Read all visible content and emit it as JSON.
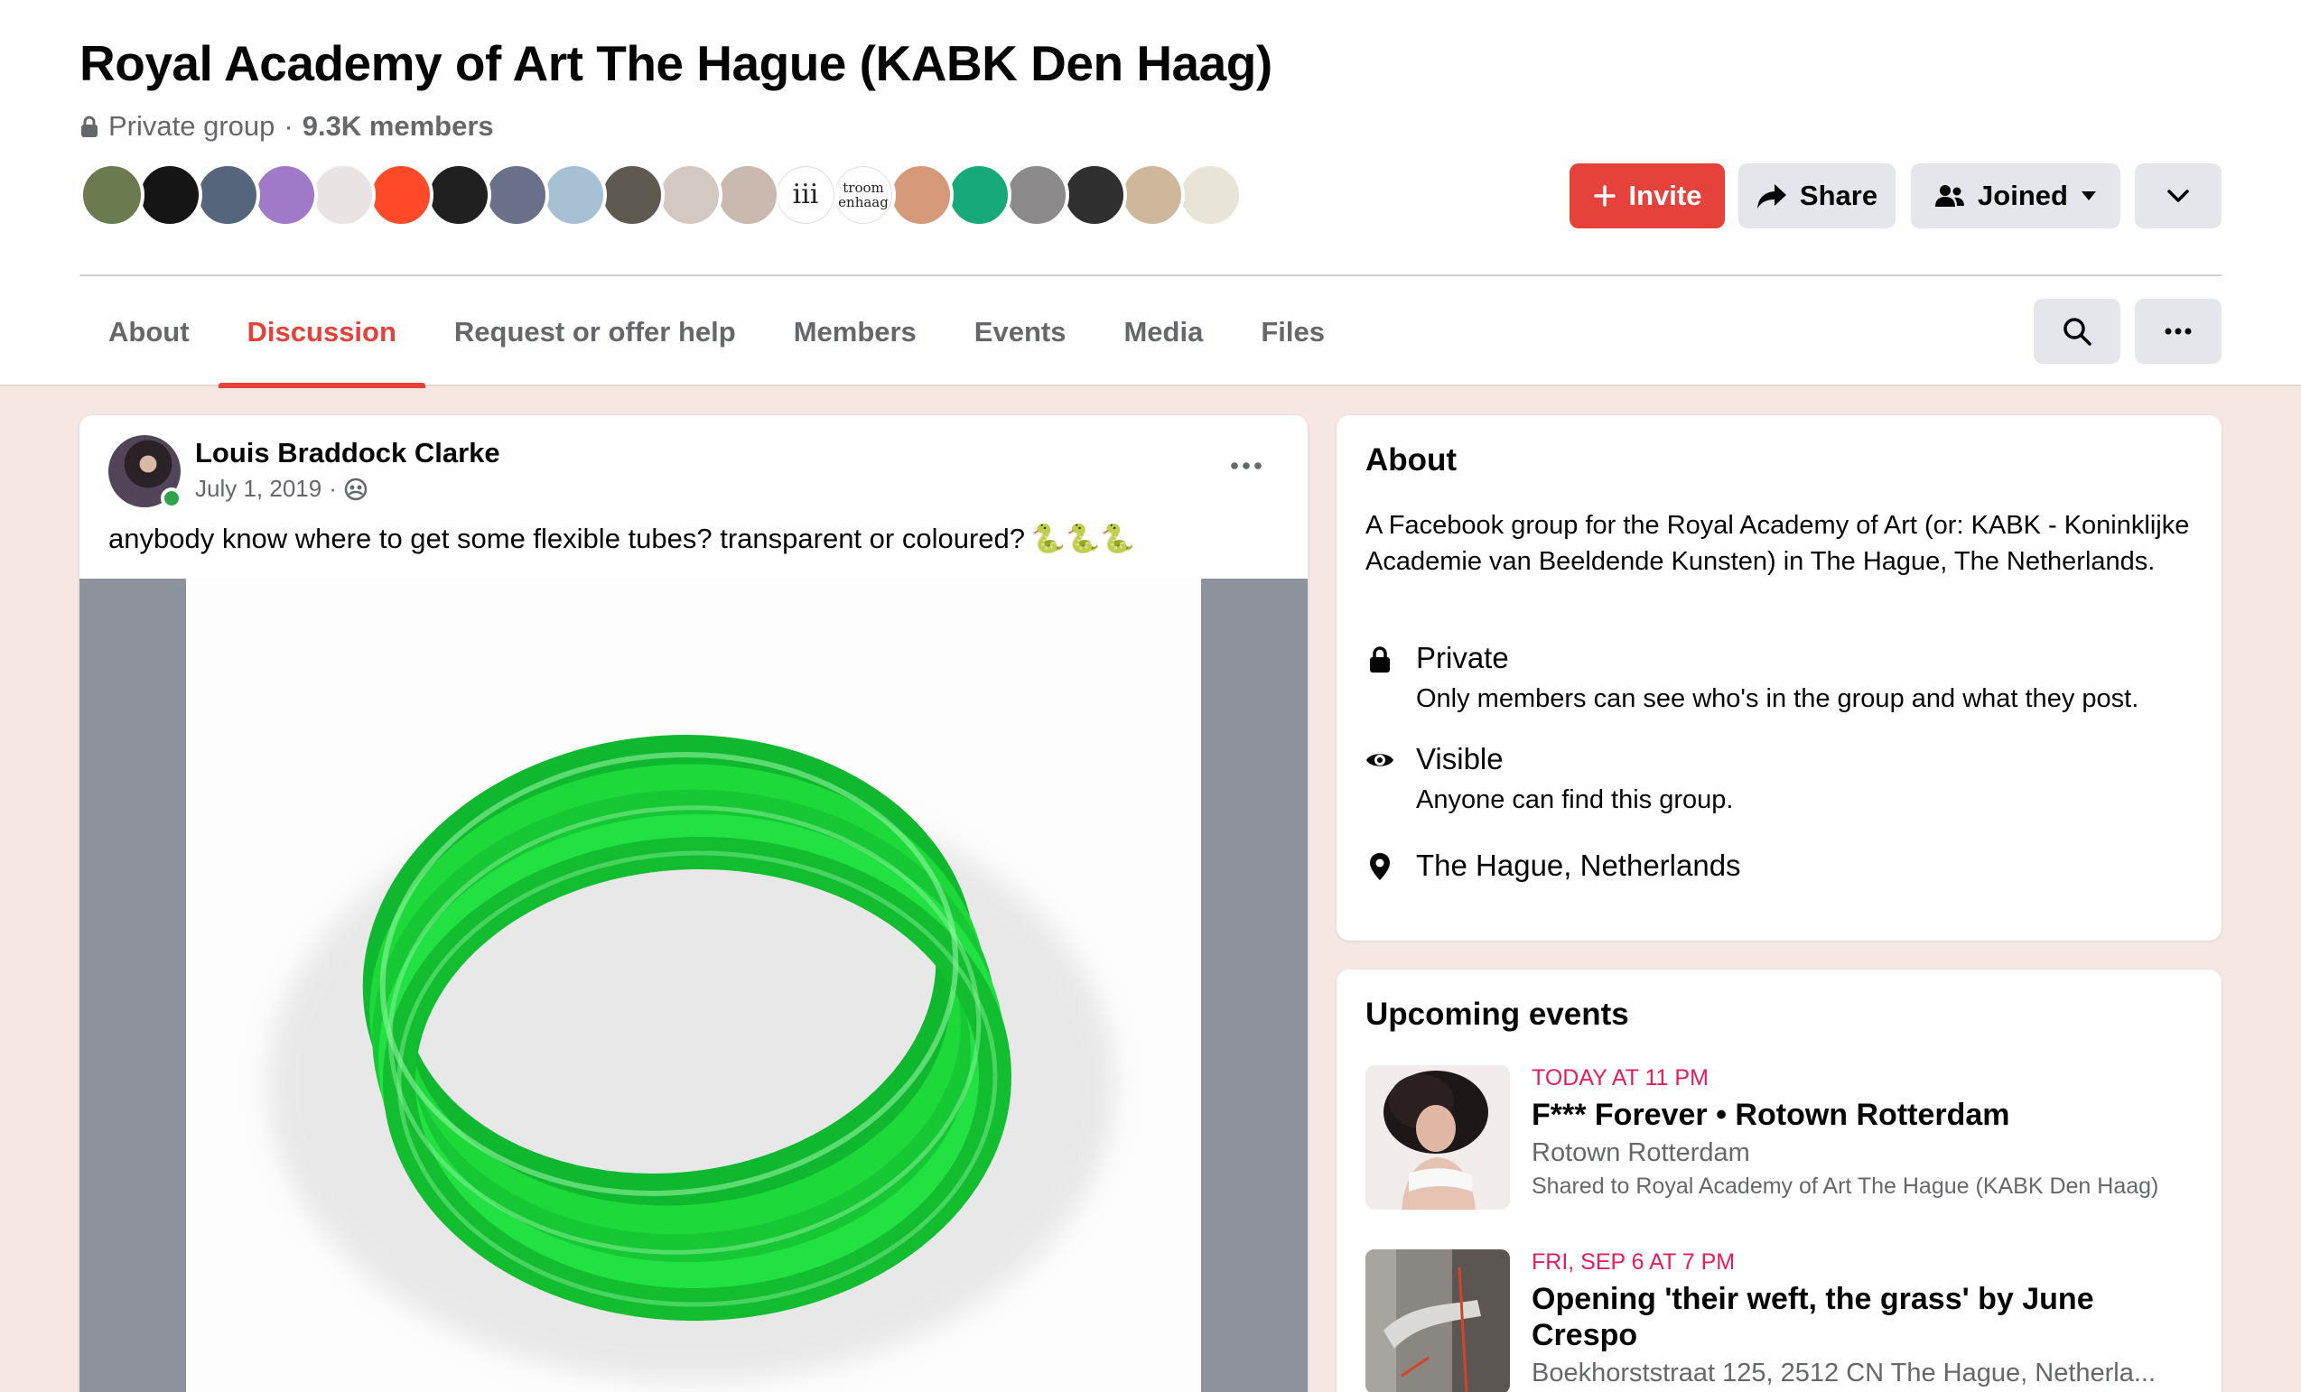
{
  "group": {
    "title": "Royal Academy of Art The Hague (KABK Den Haag)",
    "privacy": "Private group",
    "separator": "·",
    "members": "9.3K members"
  },
  "avatars": [
    {
      "bg": "#6c7a50"
    },
    {
      "bg": "#151515"
    },
    {
      "bg": "#54657c"
    },
    {
      "bg": "#a07ac8"
    },
    {
      "bg": "#eae3e3"
    },
    {
      "bg": "#ff4a2a"
    },
    {
      "bg": "#202020"
    },
    {
      "bg": "#6a7089"
    },
    {
      "bg": "#a8c0d4"
    },
    {
      "bg": "#5e5a52"
    },
    {
      "bg": "#d4c8c2"
    },
    {
      "bg": "#c9b9ae"
    },
    {
      "bg": "#ffffff",
      "text": "iii"
    },
    {
      "bg": "#ffffff",
      "text": "troom enhaag"
    },
    {
      "bg": "#d69a7a"
    },
    {
      "bg": "#18a97a"
    },
    {
      "bg": "#8c8a8a"
    },
    {
      "bg": "#2f2f2f"
    },
    {
      "bg": "#cfb79b"
    },
    {
      "bg": "#e8e4d8"
    }
  ],
  "actions": {
    "invite": "Invite",
    "share": "Share",
    "joined": "Joined"
  },
  "tabs": [
    {
      "label": "About"
    },
    {
      "label": "Discussion"
    },
    {
      "label": "Request or offer help"
    },
    {
      "label": "Members"
    },
    {
      "label": "Events"
    },
    {
      "label": "Media"
    },
    {
      "label": "Files"
    }
  ],
  "post": {
    "author": "Louis Braddock Clarke",
    "date": "July 1, 2019",
    "dot": "·",
    "text": "anybody know where to get some flexible tubes? transparent or coloured?",
    "emoji": "🐍🐍🐍"
  },
  "about": {
    "title": "About",
    "description": "A Facebook group for the Royal Academy of Art (or: KABK - Koninklijke Academie van Beeldende Kunsten) in The Hague, The Netherlands.",
    "private_title": "Private",
    "private_desc": "Only members can see who's in the group and what they post.",
    "visible_title": "Visible",
    "visible_desc": "Anyone can find this group.",
    "location": "The Hague, Netherlands"
  },
  "events": {
    "title": "Upcoming events",
    "items": [
      {
        "when": "TODAY AT 11 PM",
        "title": "F*** Forever • Rotown Rotterdam",
        "location": "Rotown Rotterdam",
        "shared": "Shared to Royal Academy of Art The Hague (KABK Den Haag)"
      },
      {
        "when": "FRI, SEP 6 AT 7 PM",
        "title": "Opening 'their weft, the grass' by June Crespo",
        "location": "Boekhorststraat 125, 2512 CN The Hague, Netherla..."
      }
    ]
  },
  "colors": {
    "accent": "#e4423a",
    "page_bg": "#f6e7e3",
    "event_date": "#e41e5b",
    "secondary_text": "#65676b",
    "tube_green": "#1ed93a"
  }
}
